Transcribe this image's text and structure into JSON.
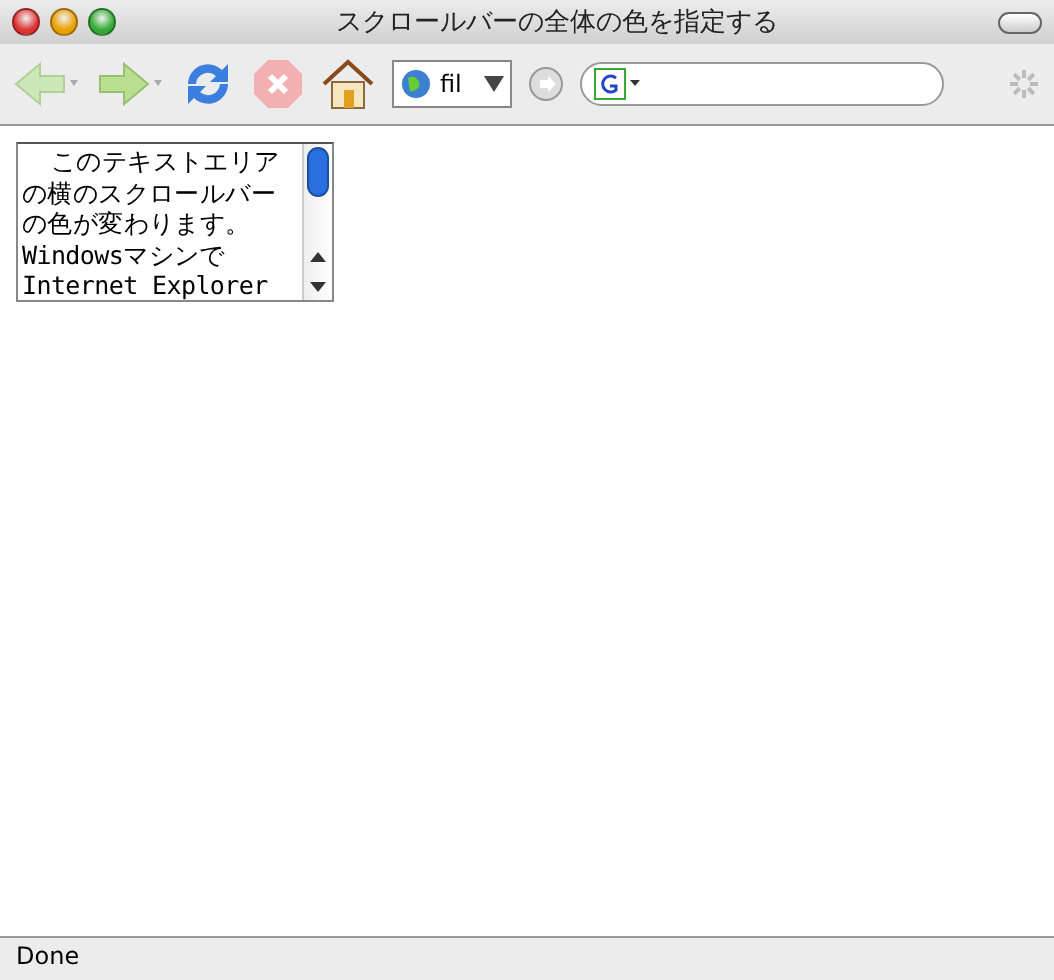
{
  "window": {
    "title": "スクロールバーの全体の色を指定する"
  },
  "toolbar": {
    "location": "fil"
  },
  "textarea": {
    "lines": [
      "  このテキストエリア",
      "の横のスクロールバー",
      "の色が変わります。",
      "Windowsマシンで",
      "Internet Explorer"
    ]
  },
  "status_bar": "Done"
}
